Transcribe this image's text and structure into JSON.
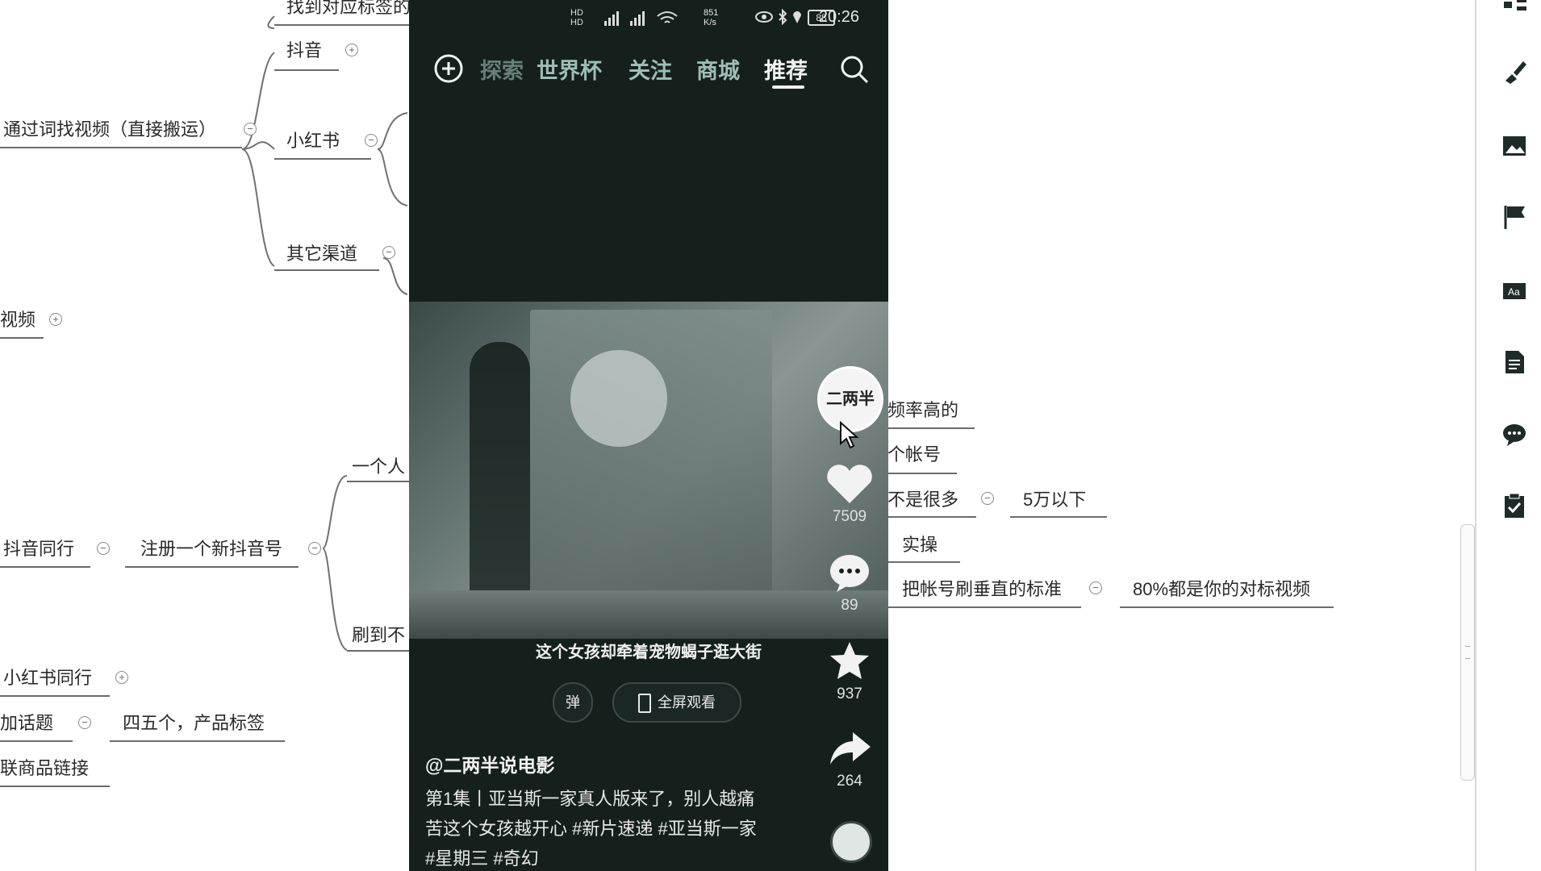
{
  "mindmap": {
    "top_partial": "找到对应标签的",
    "douyin": "抖音",
    "find_by_word": "通过词找视频（直接搬运）",
    "xiaohongshu": "小红书",
    "other_channels": "其它渠道",
    "video_partial": "视频",
    "one_person_partial": "一个人",
    "douyin_peer": "抖音同行",
    "register_new": "注册一个新抖音号",
    "brush_partial": "刷到不",
    "xhs_peer": "小红书同行",
    "add_topic": "加话题",
    "four_five": "四五个，产品标签",
    "link_goods": "联商品链接",
    "high_freq": "频率高的",
    "account_partial": "个帐号",
    "not_many": "不是很多",
    "under_50k": "5万以下",
    "practice": "实操",
    "vertical_standard": "把帐号刷垂直的标准",
    "eighty_percent": "80%都是你的对标视频"
  },
  "phone": {
    "status": {
      "time": "20:26",
      "battery": "88",
      "speed": "851 K/s",
      "net1": "HD",
      "net2": "HD"
    },
    "tabs": [
      "探索",
      "世界杯",
      "关注",
      "商城",
      "推荐"
    ],
    "active_tab": "推荐",
    "subtitle": "这个女孩却牵着宠物蝎子逛大街",
    "danmu_label": "弹",
    "fullscreen_label": "全屏观看",
    "author": "@二两半说电影",
    "description": "第1集丨亚当斯一家真人版来了，别人越痛苦这个女孩越开心 #新片速递 #亚当斯一家 #星期三 #奇幻",
    "avatar_text": "二两半",
    "likes": "7509",
    "comments": "89",
    "favorites": "937",
    "shares": "264",
    "accent_color": "#f2f2f2",
    "background_color": "#15201c"
  },
  "toolbar": {
    "icons": [
      "structure-icon",
      "brush-icon",
      "image-icon",
      "flag-icon",
      "text-style-icon",
      "note-icon",
      "comment-icon",
      "task-icon"
    ]
  }
}
